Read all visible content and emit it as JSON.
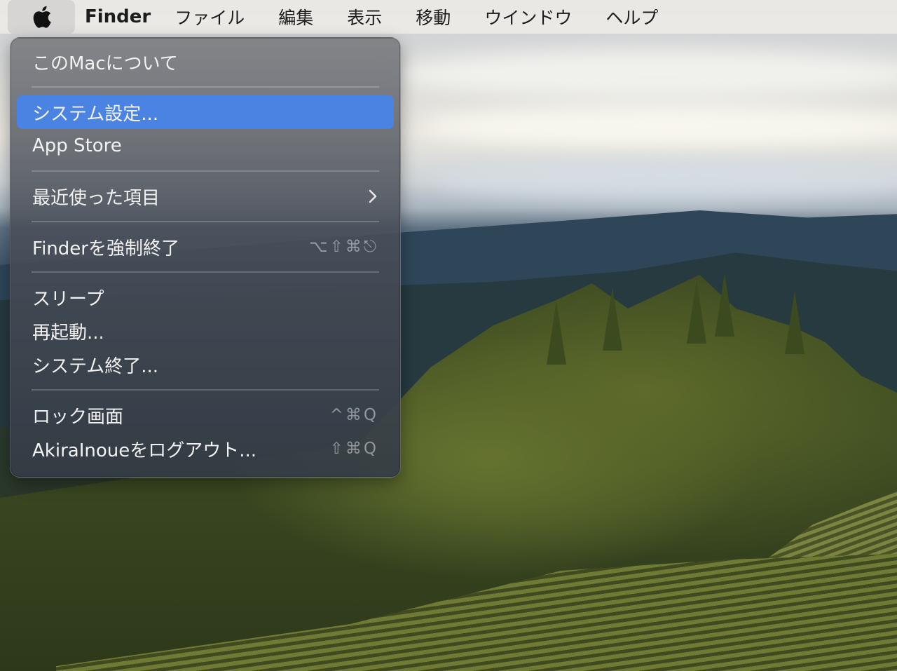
{
  "menubar": {
    "app_name": "Finder",
    "items": [
      "ファイル",
      "編集",
      "表示",
      "移動",
      "ウインドウ",
      "ヘルプ"
    ]
  },
  "apple_menu": {
    "about": "このMacについて",
    "system_settings": "システム設定...",
    "app_store": "App Store",
    "recent_items": "最近使った項目",
    "force_quit": "Finderを強制終了",
    "force_quit_shortcut": "⌥⇧⌘⎋",
    "sleep": "スリープ",
    "restart": "再起動...",
    "shut_down": "システム終了...",
    "lock_screen": "ロック画面",
    "lock_screen_shortcut": "^⌘Q",
    "log_out": "AkiraInoueをログアウト...",
    "log_out_shortcut": "⇧⌘Q"
  },
  "colors": {
    "selection": "#4b83e3",
    "menubar": "#eceae6"
  }
}
